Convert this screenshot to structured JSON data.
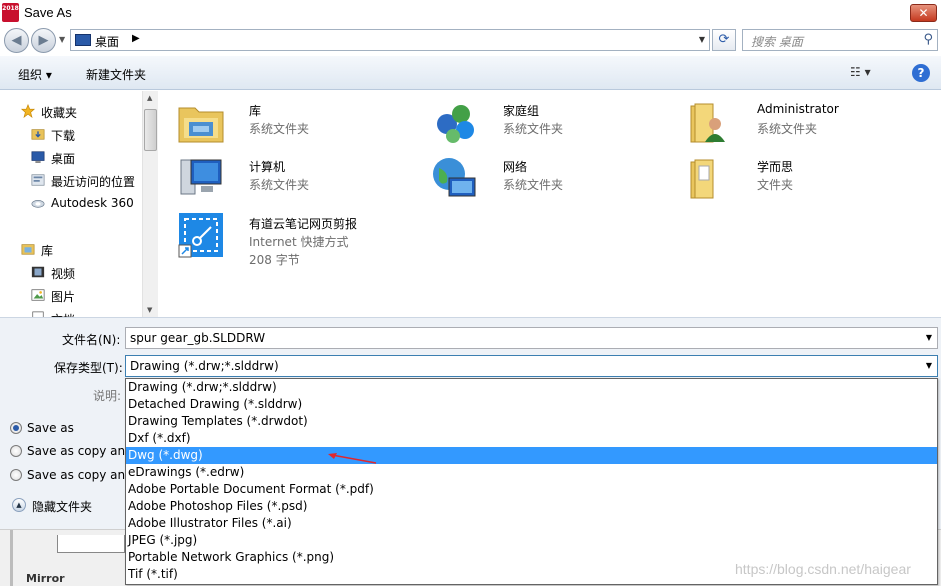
{
  "window": {
    "title": "Save As",
    "app_badge": "2018"
  },
  "nav": {
    "location": "桌面",
    "search_placeholder": "搜索 桌面"
  },
  "toolbar": {
    "organize": "组织 ▾",
    "new_folder": "新建文件夹"
  },
  "sidebar": {
    "groups": [
      {
        "label": "收藏夹",
        "icon": "star-icon"
      },
      {
        "label": "下载",
        "icon": "download-folder-icon"
      },
      {
        "label": "桌面",
        "icon": "desktop-icon"
      },
      {
        "label": "最近访问的位置",
        "icon": "recent-places-icon"
      },
      {
        "label": "Autodesk 360",
        "icon": "cloud-icon"
      },
      {
        "label": "库",
        "icon": "library-icon"
      },
      {
        "label": "视频",
        "icon": "video-icon"
      },
      {
        "label": "图片",
        "icon": "picture-icon"
      },
      {
        "label": "文档",
        "icon": "document-icon"
      }
    ]
  },
  "files": [
    {
      "name": "库",
      "type": "系统文件夹",
      "icon": "library-folder-icon"
    },
    {
      "name": "家庭组",
      "type": "系统文件夹",
      "icon": "homegroup-icon"
    },
    {
      "name": "Administrator",
      "type": "系统文件夹",
      "icon": "user-folder-icon"
    },
    {
      "name": "计算机",
      "type": "系统文件夹",
      "icon": "computer-icon"
    },
    {
      "name": "网络",
      "type": "系统文件夹",
      "icon": "network-icon"
    },
    {
      "name": "学而思",
      "type": "文件夹",
      "icon": "folder-icon"
    },
    {
      "name": "有道云笔记网页剪报",
      "type": "Internet 快捷方式",
      "size": "208 字节",
      "icon": "youdao-clipper-icon"
    }
  ],
  "form": {
    "filename_label": "文件名(N):",
    "filename_value": "spur gear_gb.SLDDRW",
    "filetype_label": "保存类型(T):",
    "filetype_value": "Drawing (*.drw;*.slddrw)",
    "description_label": "说明:",
    "save_options": [
      {
        "label": "Save as",
        "checked": true
      },
      {
        "label": "Save as copy anc"
      },
      {
        "label": "Save as copy anc"
      }
    ],
    "hide_folders": "隐藏文件夹"
  },
  "filetype_options": [
    "Drawing (*.drw;*.slddrw)",
    "Detached Drawing (*.slddrw)",
    "Drawing Templates (*.drwdot)",
    "Dxf (*.dxf)",
    "Dwg (*.dwg)",
    "eDrawings (*.edrw)",
    "Adobe Portable Document Format (*.pdf)",
    "Adobe Photoshop Files (*.psd)",
    "Adobe Illustrator Files (*.ai)",
    "JPEG (*.jpg)",
    "Portable Network Graphics (*.png)",
    "Tif (*.tif)"
  ],
  "selected_option_index": 4,
  "background_panel": {
    "label": "Mirror"
  },
  "watermark": "https://blog.csdn.net/haigear",
  "colors": {
    "selection": "#3399ff",
    "arrow": "#e0282f",
    "accent": "#2a5aa8"
  }
}
